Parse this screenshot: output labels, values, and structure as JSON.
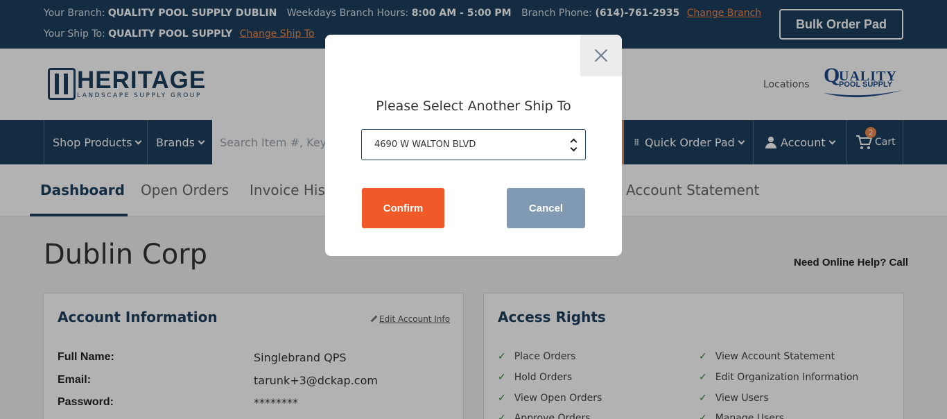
{
  "topbar": {
    "branch_label": "Your Branch:",
    "branch_name": "QUALITY POOL SUPPLY DUBLIN",
    "hours_label": "Weekdays Branch Hours:",
    "hours_value": "8:00 AM - 5:00 PM",
    "phone_label": "Branch Phone:",
    "phone_value": "(614)-761-2935",
    "change_branch": "Change Branch",
    "shipto_label": "Your Ship To:",
    "shipto_value": "QUALITY POOL SUPPLY",
    "change_shipto": "Change Ship To",
    "bulk_order": "Bulk Order Pad"
  },
  "header": {
    "logo_name": "HERITAGE",
    "logo_sub": "LANDSCAPE SUPPLY GROUP",
    "locations": "Locations",
    "partner_logo_q": "Q",
    "partner_logo_line1": "UALITY",
    "partner_logo_line2": "POOL SUPPLY"
  },
  "nav": {
    "shop_products": "Shop Products",
    "brands": "Brands",
    "search_placeholder": "Search Item #, Keyword...",
    "quick_order": "Quick Order Pad",
    "account": "Account",
    "cart": "Cart",
    "cart_count": "2"
  },
  "tabs": [
    {
      "label": "Dashboard"
    },
    {
      "label": "Open Orders"
    },
    {
      "label": "Invoice History"
    },
    {
      "label": "Account Statement"
    }
  ],
  "page": {
    "title": "Dublin Corp",
    "help": "Need Online Help? Call"
  },
  "account_info": {
    "title": "Account Information",
    "edit_link": "Edit Account Info",
    "rows": [
      {
        "label": "Full Name:",
        "value": "Singlebrand QPS"
      },
      {
        "label": "Email:",
        "value": "tarunk+3@dckap.com"
      },
      {
        "label": "Password:",
        "value": "********"
      }
    ]
  },
  "access_rights": {
    "title": "Access Rights",
    "left": [
      "Place Orders",
      "Hold Orders",
      "View Open Orders",
      "Approve Orders"
    ],
    "right": [
      "View Account Statement",
      "Edit Organization Information",
      "View Users",
      "Manage Users"
    ]
  },
  "modal": {
    "title": "Please Select Another Ship To",
    "selected_ship_to": "4690 W WALTON BLVD",
    "confirm": "Confirm",
    "cancel": "Cancel"
  },
  "colors": {
    "navy": "#1d3f5e",
    "orange": "#f05a28",
    "link_orange": "#f0894e",
    "cancel_gray_blue": "#7f9ab2"
  }
}
